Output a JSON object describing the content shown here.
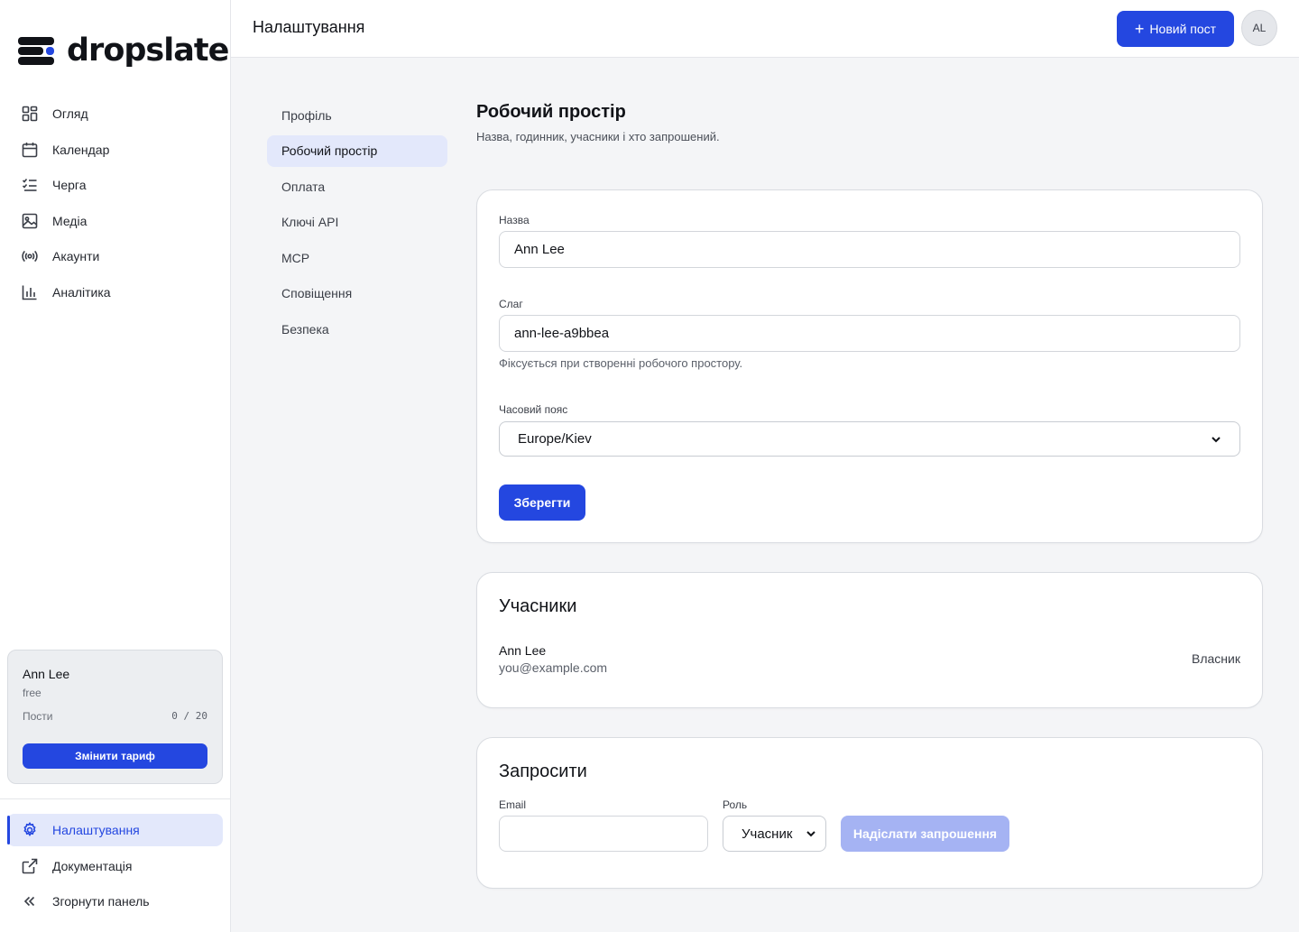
{
  "brand": {
    "name": "dropslate"
  },
  "sidebar": {
    "items": [
      {
        "label": "Огляд"
      },
      {
        "label": "Календар"
      },
      {
        "label": "Черга"
      },
      {
        "label": "Медіа"
      },
      {
        "label": "Акаунти"
      },
      {
        "label": "Аналітика"
      }
    ],
    "plan": {
      "user_name": "Ann Lee",
      "tier": "free",
      "posts_label": "Пости",
      "posts_count": "0 / 20",
      "change_plan_label": "Змінити тариф"
    },
    "bottom_items": [
      {
        "label": "Налаштування"
      },
      {
        "label": "Документація"
      },
      {
        "label": "Згорнути панель"
      }
    ]
  },
  "header": {
    "title": "Налаштування",
    "new_post_label": "Новий пост",
    "avatar_initials": "AL"
  },
  "settings_nav": {
    "items": [
      {
        "label": "Профіль"
      },
      {
        "label": "Робочий простір"
      },
      {
        "label": "Оплата"
      },
      {
        "label": "Ключі API"
      },
      {
        "label": "MCP"
      },
      {
        "label": "Сповіщення"
      },
      {
        "label": "Безпека"
      }
    ],
    "active_index": 1
  },
  "workspace": {
    "title": "Робочий простір",
    "description": "Назва, годинник, учасники і хто запрошений.",
    "name_label": "Назва",
    "name_value": "Ann Lee",
    "slug_label": "Слаг",
    "slug_value": "ann-lee-a9bbea",
    "slug_hint": "Фіксується при створенні робочого простору.",
    "timezone_label": "Часовий пояс",
    "timezone_value": "Europe/Kiev",
    "save_label": "Зберегти"
  },
  "members": {
    "title": "Учасники",
    "list": [
      {
        "name": "Ann Lee",
        "email": "you@example.com",
        "role": "Власник"
      }
    ]
  },
  "invite": {
    "title": "Запросити",
    "email_label": "Email",
    "email_value": "",
    "role_label": "Роль",
    "role_value": "Учасник",
    "send_label": "Надіслати запрошення"
  },
  "colors": {
    "accent": "#2447e0",
    "accent_soft": "#e3e8fb",
    "disabled_button": "#a5b3f3"
  }
}
